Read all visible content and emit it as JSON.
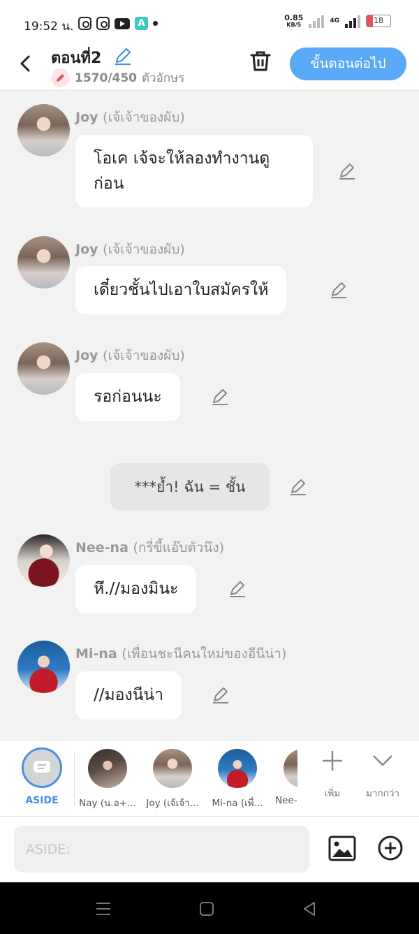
{
  "status_bar": {
    "time": "19:52 น.",
    "net_speed": "0.85",
    "net_unit": "KB/S",
    "network_type": "4G",
    "battery": "18",
    "icons": [
      "instagram-icon",
      "instagram-icon",
      "youtube-icon",
      "app-a-icon",
      "dot-icon"
    ]
  },
  "header": {
    "title": "ตอนที่2",
    "char_count": "1570/450",
    "char_unit": "ตัวอักษร",
    "next_button": "ขั้นตอนต่อไป"
  },
  "messages": [
    {
      "name": "Joy",
      "role": "(เจ้เจ้าของผับ)",
      "text": "โอเค เจ้จะให้ลองทำงานดู\nก่อน",
      "avatar": "joy"
    },
    {
      "name": "Joy",
      "role": "(เจ้เจ้าของผับ)",
      "text": "เดี๋ยวชั้นไปเอาใบสมัครให้",
      "avatar": "joy"
    },
    {
      "name": "Joy",
      "role": "(เจ้เจ้าของผับ)",
      "text": "รอก่อนนะ",
      "avatar": "joy"
    },
    {
      "type": "aside",
      "text": "***ย้ำ! ฉัน = ชั้น"
    },
    {
      "name": "Nee-na",
      "role": "(กรี่ขี้แอ๊บตัวนึง)",
      "text": "หึ.//มองมินะ",
      "avatar": "neena"
    },
    {
      "name": "Mi-na",
      "role": "(เพื่อนชะนีคนใหม่ของอีนีน่า)",
      "text": "//มองนีน่า",
      "avatar": "mina"
    }
  ],
  "character_bar": {
    "aside_label": "ASIDE",
    "characters": [
      {
        "label": "Nay (น.อ+...",
        "avatar": "nay"
      },
      {
        "label": "Joy (เจ้เจ้า...",
        "avatar": "joy"
      },
      {
        "label": "Mi-na (เพื่...",
        "avatar": "mina"
      },
      {
        "label": "Nee-",
        "avatar": "joy"
      }
    ],
    "add_label": "เพิ่ม",
    "more_label": "มากกว่า"
  },
  "input": {
    "placeholder": "ASIDE:"
  },
  "colors": {
    "accent": "#5aa9f6",
    "aside_blue": "#4a90e2",
    "background": "#f2f2f2",
    "bubble": "#ffffff",
    "aside_bubble": "#e6e6e6",
    "battery_low": "#e8505b"
  }
}
